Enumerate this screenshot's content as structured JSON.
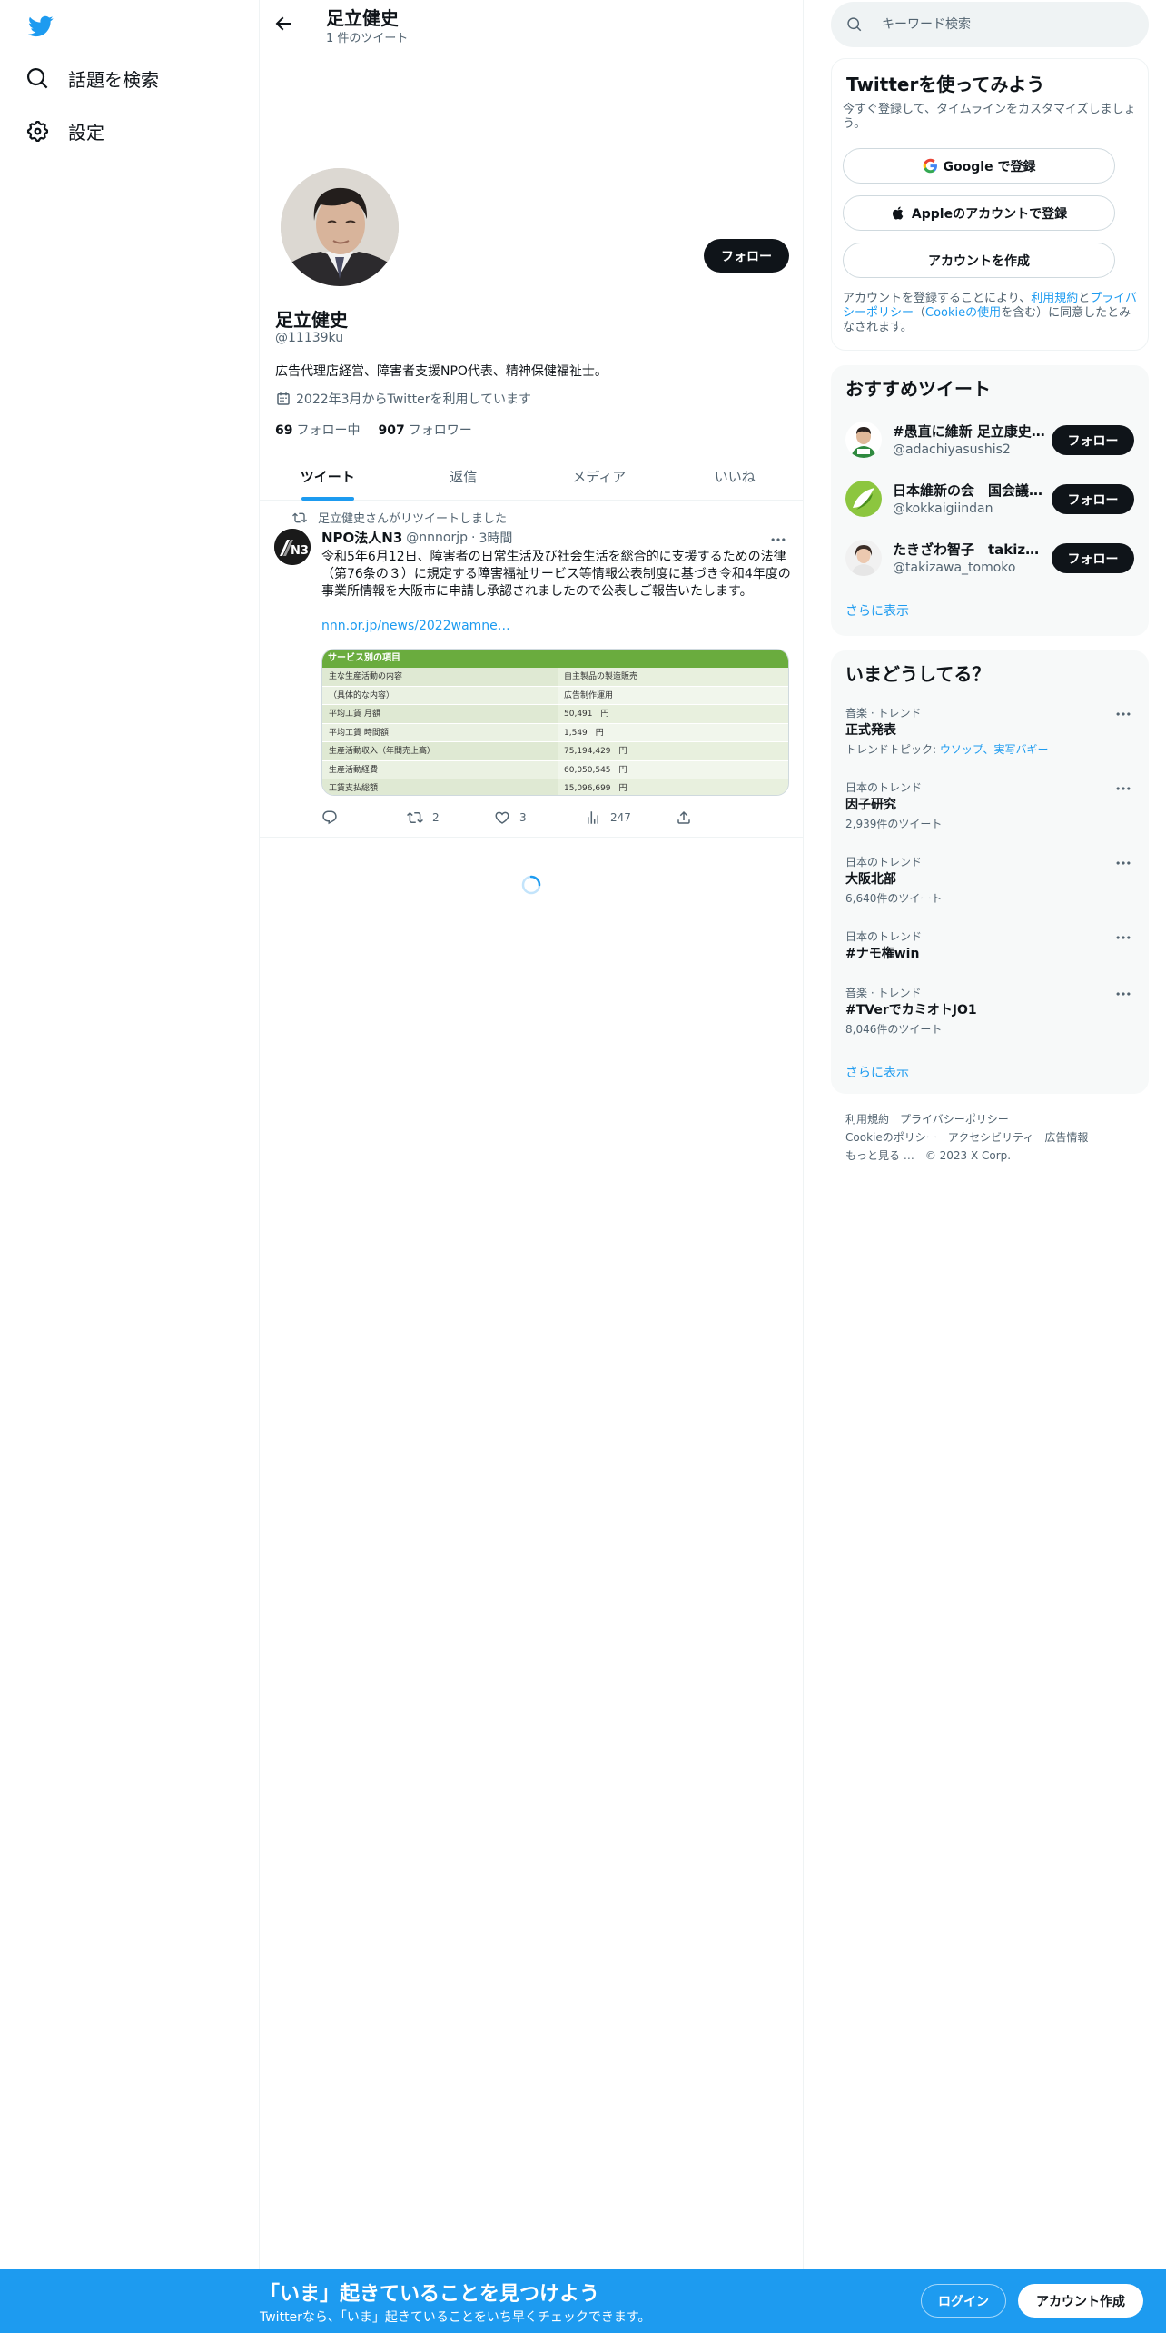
{
  "nav": {
    "explore_label": "話題を検索",
    "settings_label": "設定"
  },
  "header": {
    "name": "足立健史",
    "tweet_count": "1 件のツイート"
  },
  "profile": {
    "follow_label": "フォロー",
    "name": "足立健史",
    "handle": "@11139ku",
    "bio": "広告代理店経営、障害者支援NPO代表、精神保健福祉士。",
    "joined": "2022年3月からTwitterを利用しています",
    "following_count": "69",
    "following_label": "フォロー中",
    "followers_count": "907",
    "followers_label": "フォロワー"
  },
  "tabs": [
    {
      "label": "ツイート"
    },
    {
      "label": "返信"
    },
    {
      "label": "メディア"
    },
    {
      "label": "いいね"
    }
  ],
  "tweet": {
    "retweeted_by": "足立健史さんがリツイートしました",
    "author_name": "NPO法人N3",
    "author_handle": "@nnnorjp",
    "time": "3時間",
    "text": "令和5年6月12日、障害者の日常生活及び社会生活を総合的に支援するための法律（第76条の３）に規定する障害福祉サービス等情報公表制度に基づき令和4年度の事業所情報を大阪市に申請し承認されましたので公表しご報告いたします。",
    "link": "nnn.or.jp/news/2022wamne…",
    "avatar_text": "N3",
    "card": {
      "header": "サービス別の項目",
      "rows": [
        {
          "label": "主な生産活動の内容",
          "value": "自主製品の製造販売"
        },
        {
          "label": "（具体的な内容）",
          "value": "広告制作運用"
        },
        {
          "label": "平均工賃 月額",
          "value": "50,491　円"
        },
        {
          "label": "平均工賃 時間額",
          "value": "1,549　円"
        },
        {
          "label": "生産活動収入（年間売上高）",
          "value": "75,194,429　円"
        },
        {
          "label": "生産活動経費",
          "value": "60,050,545　円"
        },
        {
          "label": "工賃支払総額",
          "value": "15,096,699　円"
        }
      ]
    },
    "retweets": "2",
    "likes": "3",
    "views": "247"
  },
  "search": {
    "placeholder": "キーワード検索"
  },
  "signup": {
    "title": "Twitterを使ってみよう",
    "subtitle": "今すぐ登録して、タイムラインをカスタマイズしましょう。",
    "google_label": "Google で登録",
    "apple_label": "Appleのアカウントで登録",
    "create_label": "アカウントを作成",
    "terms_prefix": "アカウントを登録することにより、",
    "terms_link": "利用規約",
    "terms_and": "と",
    "privacy_link": "プライバシーポリシー",
    "cookie_open": "（",
    "cookie_link": "Cookieの使用",
    "terms_suffix": "を含む）に同意したとみなされます。"
  },
  "recommended": {
    "title": "おすすめツイート",
    "items": [
      {
        "name": "#愚直に維新 足立康史…",
        "handle": "@adachiyasushis2",
        "follow_label": "フォロー"
      },
      {
        "name": "日本維新の会　国会議…",
        "handle": "@kokkaigiindan",
        "follow_label": "フォロー"
      },
      {
        "name": "たきざわ智子　takiza…",
        "handle": "@takizawa_tomoko",
        "follow_label": "フォロー"
      }
    ],
    "show_more": "さらに表示"
  },
  "trends": {
    "title": "いまどうしてる？",
    "items": [
      {
        "context": "音楽 · トレンド",
        "name": "正式発表",
        "meta_prefix": "トレンドトピック: ",
        "meta_links": "ウソップ、実写バギー",
        "meta": ""
      },
      {
        "context": "日本のトレンド",
        "name": "因子研究",
        "meta_prefix": "",
        "meta_links": "",
        "meta": "2,939件のツイート"
      },
      {
        "context": "日本のトレンド",
        "name": "大阪北部",
        "meta_prefix": "",
        "meta_links": "",
        "meta": "6,640件のツイート"
      },
      {
        "context": "日本のトレンド",
        "name": "#ナモ権win",
        "meta_prefix": "",
        "meta_links": "",
        "meta": ""
      },
      {
        "context": "音楽 · トレンド",
        "name": "#TVerでカミオトJO1",
        "meta_prefix": "",
        "meta_links": "",
        "meta": "8,046件のツイート"
      }
    ],
    "show_more": "さらに表示"
  },
  "footer": {
    "terms": "利用規約",
    "privacy": "プライバシーポリシー",
    "cookie": "Cookieのポリシー",
    "accessibility": "アクセシビリティ",
    "ads": "広告情報",
    "more": "もっと見る …",
    "copyright": "© 2023 X Corp."
  },
  "bottom_bar": {
    "title": "「いま」起きていることを見つけよう",
    "subtitle": "Twitterなら、「いま」起きていることをいち早くチェックできます。",
    "login_label": "ログイン",
    "signup_label": "アカウント作成"
  },
  "colors": {
    "accent": "#1d9bf0",
    "text": "#0f1419",
    "secondary": "#536471"
  }
}
